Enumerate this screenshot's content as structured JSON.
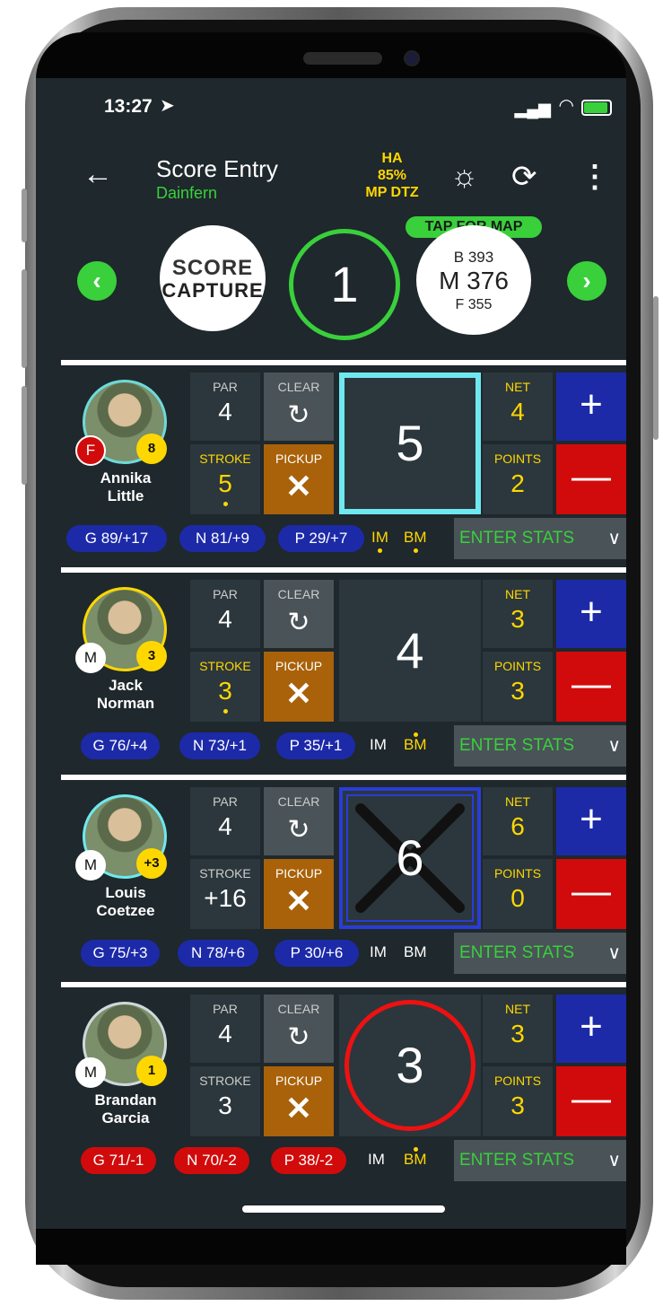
{
  "status": {
    "time": "13:27"
  },
  "header": {
    "title": "Score Entry",
    "course": "Dainfern",
    "ha_line1": "HA",
    "ha_line2": "85%",
    "ha_line3": "MP DTZ"
  },
  "hole": {
    "logo_line1": "SCORE",
    "logo_line2": "CAPTURE",
    "number": "1",
    "tap_for_map": "TAP FOR MAP",
    "back": "B 393",
    "middle": "M 376",
    "front": "F 355"
  },
  "labels": {
    "par": "PAR",
    "clear": "CLEAR",
    "stroke": "STROKE",
    "pickup": "PICKUP",
    "net": "NET",
    "points": "POINTS",
    "enter_stats": "ENTER STATS",
    "im": "IM",
    "bm": "BM"
  },
  "players": [
    {
      "first": "Annika",
      "last": "Little",
      "tee": "F",
      "handicap": "8",
      "par": "4",
      "stroke": "5",
      "score": "5",
      "net": "4",
      "points": "2",
      "g": "G 89/+17",
      "n": "N 81/+9",
      "p": "P 29/+7"
    },
    {
      "first": "Jack",
      "last": "Norman",
      "tee": "M",
      "handicap": "3",
      "par": "4",
      "stroke": "3",
      "score": "4",
      "net": "3",
      "points": "3",
      "g": "G 76/+4",
      "n": "N 73/+1",
      "p": "P 35/+1"
    },
    {
      "first": "Louis",
      "last": "Coetzee",
      "tee": "M",
      "handicap": "+3",
      "par": "4",
      "stroke": "+16",
      "score": "6",
      "net": "6",
      "points": "0",
      "g": "G 75/+3",
      "n": "N 78/+6",
      "p": "P 30/+6"
    },
    {
      "first": "Brandan",
      "last": "Garcia",
      "tee": "M",
      "handicap": "1",
      "par": "4",
      "stroke": "3",
      "score": "3",
      "net": "3",
      "points": "3",
      "g": "G 71/-1",
      "n": "N 70/-2",
      "p": "P 38/-2"
    }
  ],
  "colors": {
    "accent_green": "#39d03b",
    "yellow": "#ffd700",
    "plus_blue": "#1c2aa8",
    "minus_red": "#d10b0b",
    "pickup_orange": "#a9620a"
  }
}
